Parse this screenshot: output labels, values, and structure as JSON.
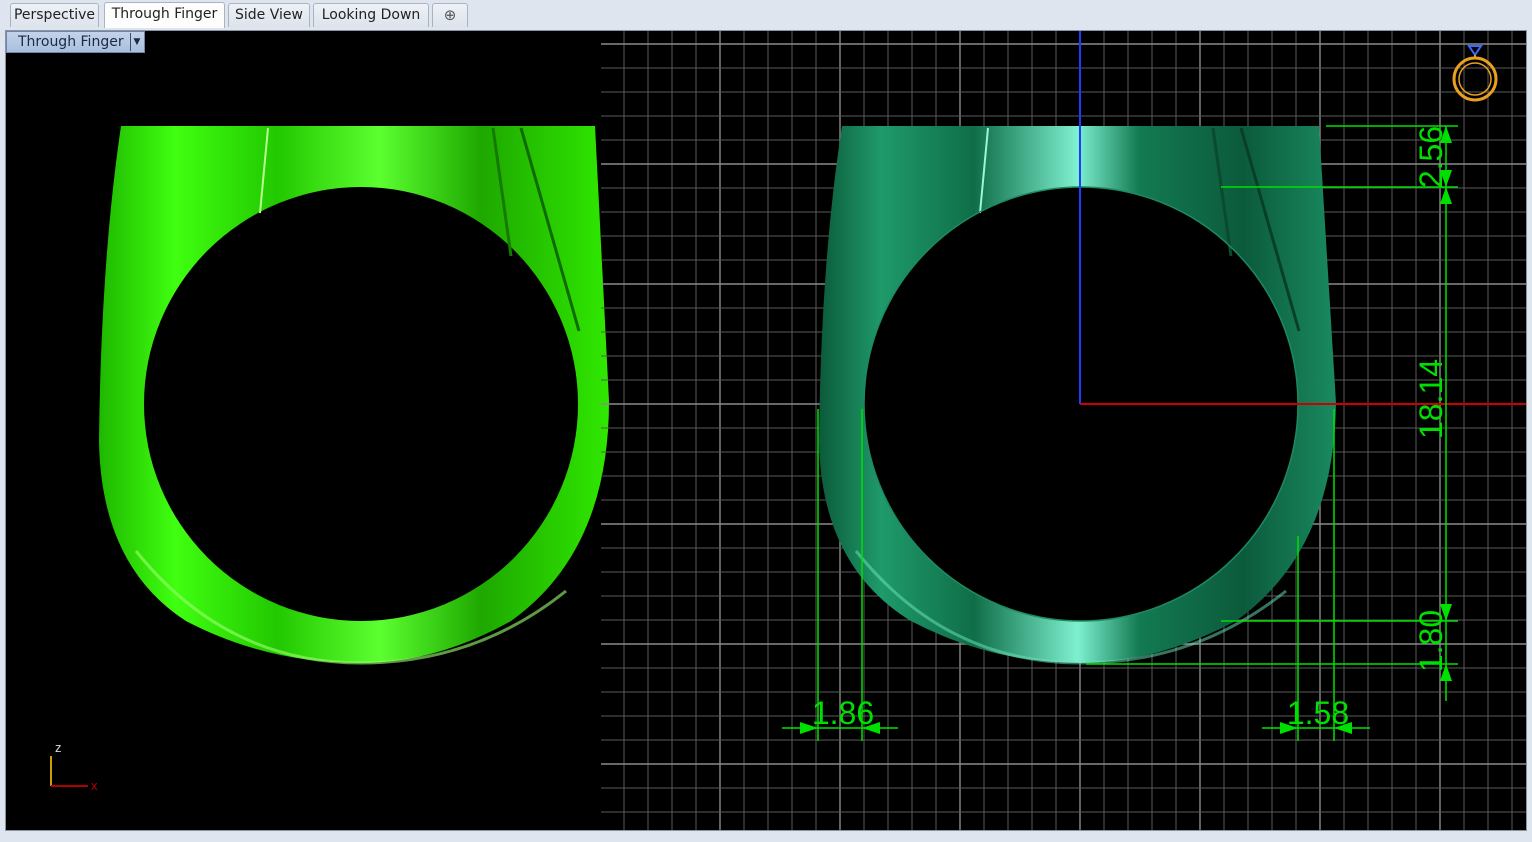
{
  "tabs": [
    {
      "label": "Perspective",
      "active": false
    },
    {
      "label": "Through Finger",
      "active": true
    },
    {
      "label": "Side View",
      "active": false
    },
    {
      "label": "Looking Down",
      "active": false
    }
  ],
  "tab_add_icon": "plus-icon",
  "viewport": {
    "title": "Through Finger",
    "dropdown_icon": "chevron-down-icon",
    "axis_labels": {
      "vertical": "z",
      "horizontal": "x"
    },
    "colors": {
      "background": "#000000",
      "grid": "#5a5a5a",
      "grid_major": "#8a8a8a",
      "dimension": "#00e000",
      "ring_shaded": "#1a8a5c",
      "ring_bright": "#33ff00",
      "axis_x": "#cc0000",
      "axis_y": "#1c3cff",
      "gumball": "#e8a020"
    },
    "dimensions": [
      {
        "id": "top-height",
        "text": "2.56"
      },
      {
        "id": "inner-diameter",
        "text": "18.14"
      },
      {
        "id": "bottom-thickness",
        "text": "1.80"
      },
      {
        "id": "left-thickness",
        "text": "1.86"
      },
      {
        "id": "right-thickness",
        "text": "1.58"
      }
    ]
  }
}
